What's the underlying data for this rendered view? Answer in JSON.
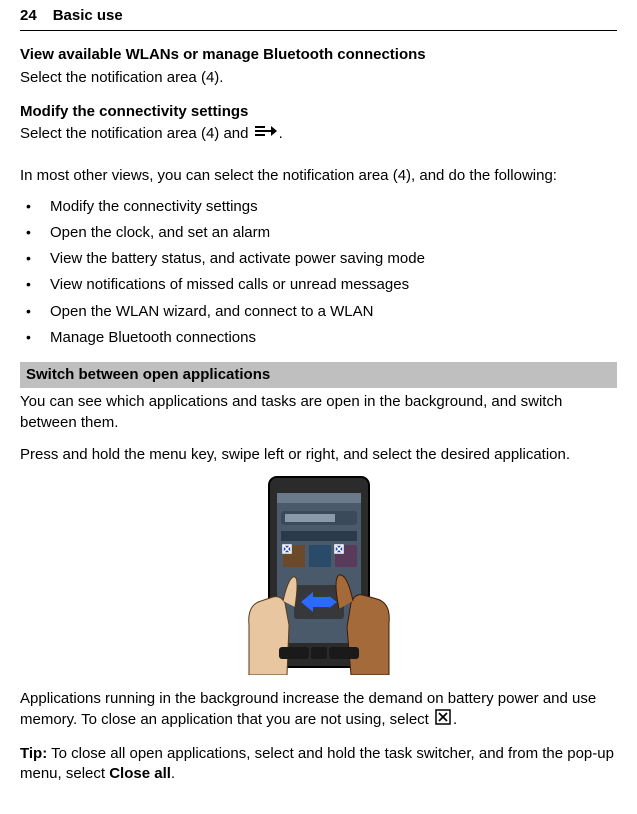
{
  "header": {
    "page_number": "24",
    "chapter_title": "Basic use"
  },
  "section_wlan": {
    "heading": "View available WLANs or manage Bluetooth connections",
    "body": "Select the notification area (4)."
  },
  "section_modify": {
    "heading": "Modify the connectivity settings",
    "body_before": "Select the notification area (4) and ",
    "body_after": "."
  },
  "intro_other_views": "In most other views, you can select the notification area (4), and do the following:",
  "bullets": [
    "Modify the connectivity settings",
    "Open the clock, and set an alarm",
    "View the battery status, and activate power saving mode",
    "View notifications of missed calls or unread messages",
    "Open the WLAN wizard, and connect to a WLAN",
    "Manage Bluetooth connections"
  ],
  "switch_section": {
    "bar": "Switch between open applications",
    "para1": "You can see which applications and tasks are open in the background, and switch between them.",
    "para2": "Press and hold the menu key, swipe left or right, and select the desired application."
  },
  "close_para": {
    "before": "Applications running in the background increase the demand on battery power and use memory. To close an application that you are not using, select ",
    "after": "."
  },
  "tip": {
    "label": "Tip:",
    "body_before": " To close all open applications, select and hold the task switcher, and from the pop-up menu, select ",
    "close_all": "Close all",
    "body_after": "."
  }
}
